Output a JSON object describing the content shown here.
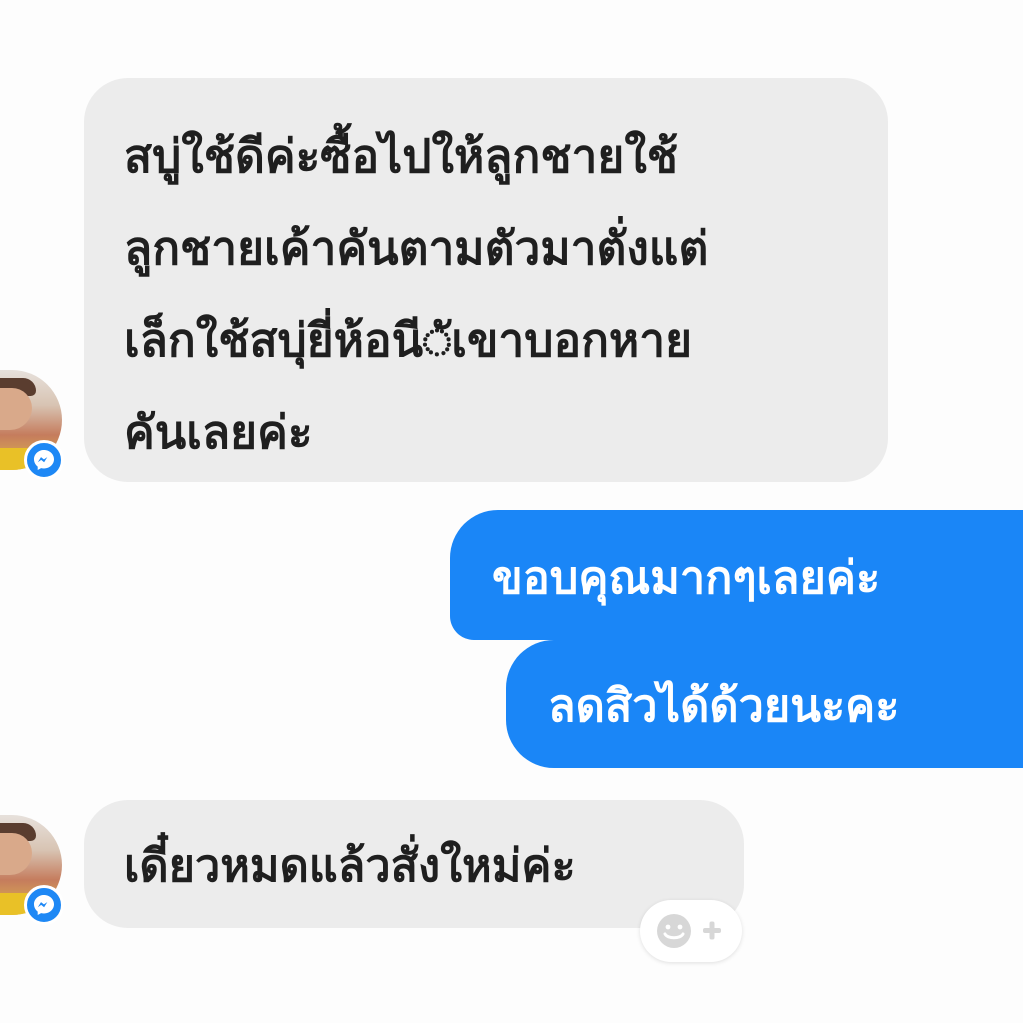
{
  "conversation": {
    "messages": [
      {
        "direction": "incoming",
        "lines": [
          "สบู่ใช้ดีค่ะซื้อไปให้ลูกชายใช้",
          "ลูกชายเค้าคันตามตัวมาตั่งแต่",
          "เล็กใช้สบุ่ยี่ห้อนี◌ัเขาบอกหาย",
          "คันเลยค่ะ"
        ]
      },
      {
        "direction": "outgoing",
        "text": "ขอบคุณมากๆเลยค่ะ"
      },
      {
        "direction": "outgoing",
        "text": "ลดสิวได้ด้วยนะคะ"
      },
      {
        "direction": "incoming",
        "text": "เดี๋ยวหมดแล้วสั่งใหม่ค่ะ"
      }
    ]
  },
  "icons": {
    "messenger_badge": "messenger-icon",
    "reaction": "add-reaction-icon"
  },
  "colors": {
    "incoming_bubble": "#ececec",
    "outgoing_bubble": "#1a86f7",
    "messenger_blue": "#1e88f5"
  }
}
